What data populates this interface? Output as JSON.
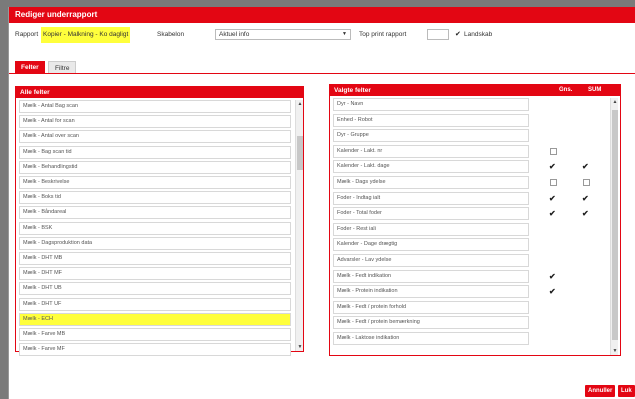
{
  "dialog": {
    "title": "Rediger underrapport"
  },
  "report_row": {
    "rapport_label": "Rapport",
    "rapport_value": "Kopier - Malkning - Ko dagligt",
    "skabelon_label": "Skabelon",
    "skabelon_value": "Aktuel info",
    "top_print_label": "Top print rapport",
    "top_print_value": "",
    "landscape_label": "Landskab",
    "landscape_checked": true
  },
  "tabs": [
    {
      "label": "Felter",
      "active": true
    },
    {
      "label": "Filtre",
      "active": false
    }
  ],
  "all_fields": {
    "title": "Alle felter",
    "items": [
      "Mælk - Antal Bag scan",
      "Mælk - Antal for scan",
      "Mælk - Antal over scan",
      "Mælk - Bag scan tid",
      "Mælk - Behandlingstid",
      "Mælk - Beskrivelse",
      "Mælk - Boks tid",
      "Mælk - Båndareal",
      "Mælk - BSK",
      "Mælk - Dagsproduktion data",
      "Mælk - DHT MB",
      "Mælk - DHT MF",
      "Mælk - DHT UB",
      "Mælk - DHT UF",
      "Mælk - ECH",
      "Mælk - Farve MB",
      "Mælk - Farve MF"
    ],
    "highlighted_index": 14
  },
  "selected_fields": {
    "title": "Valgte felter",
    "col_gns": "Gns.",
    "col_sum": "SUM",
    "items": [
      {
        "label": "Dyr - Navn",
        "gns": "none",
        "sum": "none"
      },
      {
        "label": "Enhed - Robot",
        "gns": "none",
        "sum": "none"
      },
      {
        "label": "Dyr - Gruppe",
        "gns": "none",
        "sum": "none"
      },
      {
        "label": "Kalender - Lakt. nr",
        "gns": "empty",
        "sum": "none"
      },
      {
        "label": "Kalender - Lakt. dage",
        "gns": "checked",
        "sum": "checked"
      },
      {
        "label": "Mælk - Dags ydelse",
        "gns": "empty",
        "sum": "empty"
      },
      {
        "label": "Foder - Indtag ialt",
        "gns": "checked",
        "sum": "checked"
      },
      {
        "label": "Foder - Total foder",
        "gns": "checked",
        "sum": "checked"
      },
      {
        "label": "Foder - Rest iali",
        "gns": "none",
        "sum": "none"
      },
      {
        "label": "Kalender - Dage drægtig",
        "gns": "none",
        "sum": "none"
      },
      {
        "label": "Advarsler - Lav ydelse",
        "gns": "none",
        "sum": "none"
      },
      {
        "label": "Mælk - Fedt indikation",
        "gns": "checked",
        "sum": "none"
      },
      {
        "label": "Mælk - Protein indikation",
        "gns": "checked",
        "sum": "none"
      },
      {
        "label": "Mælk - Fedt / protein forhold",
        "gns": "none",
        "sum": "none"
      },
      {
        "label": "Mælk - Fedt / protein bemærkning",
        "gns": "none",
        "sum": "none"
      },
      {
        "label": "Mælk - Laktose indikation",
        "gns": "none",
        "sum": "none"
      }
    ]
  },
  "footer": {
    "cancel_label": "Annuller",
    "save_label": "Luk"
  },
  "colors": {
    "accent": "#e30613",
    "highlight": "#ffff3c"
  }
}
